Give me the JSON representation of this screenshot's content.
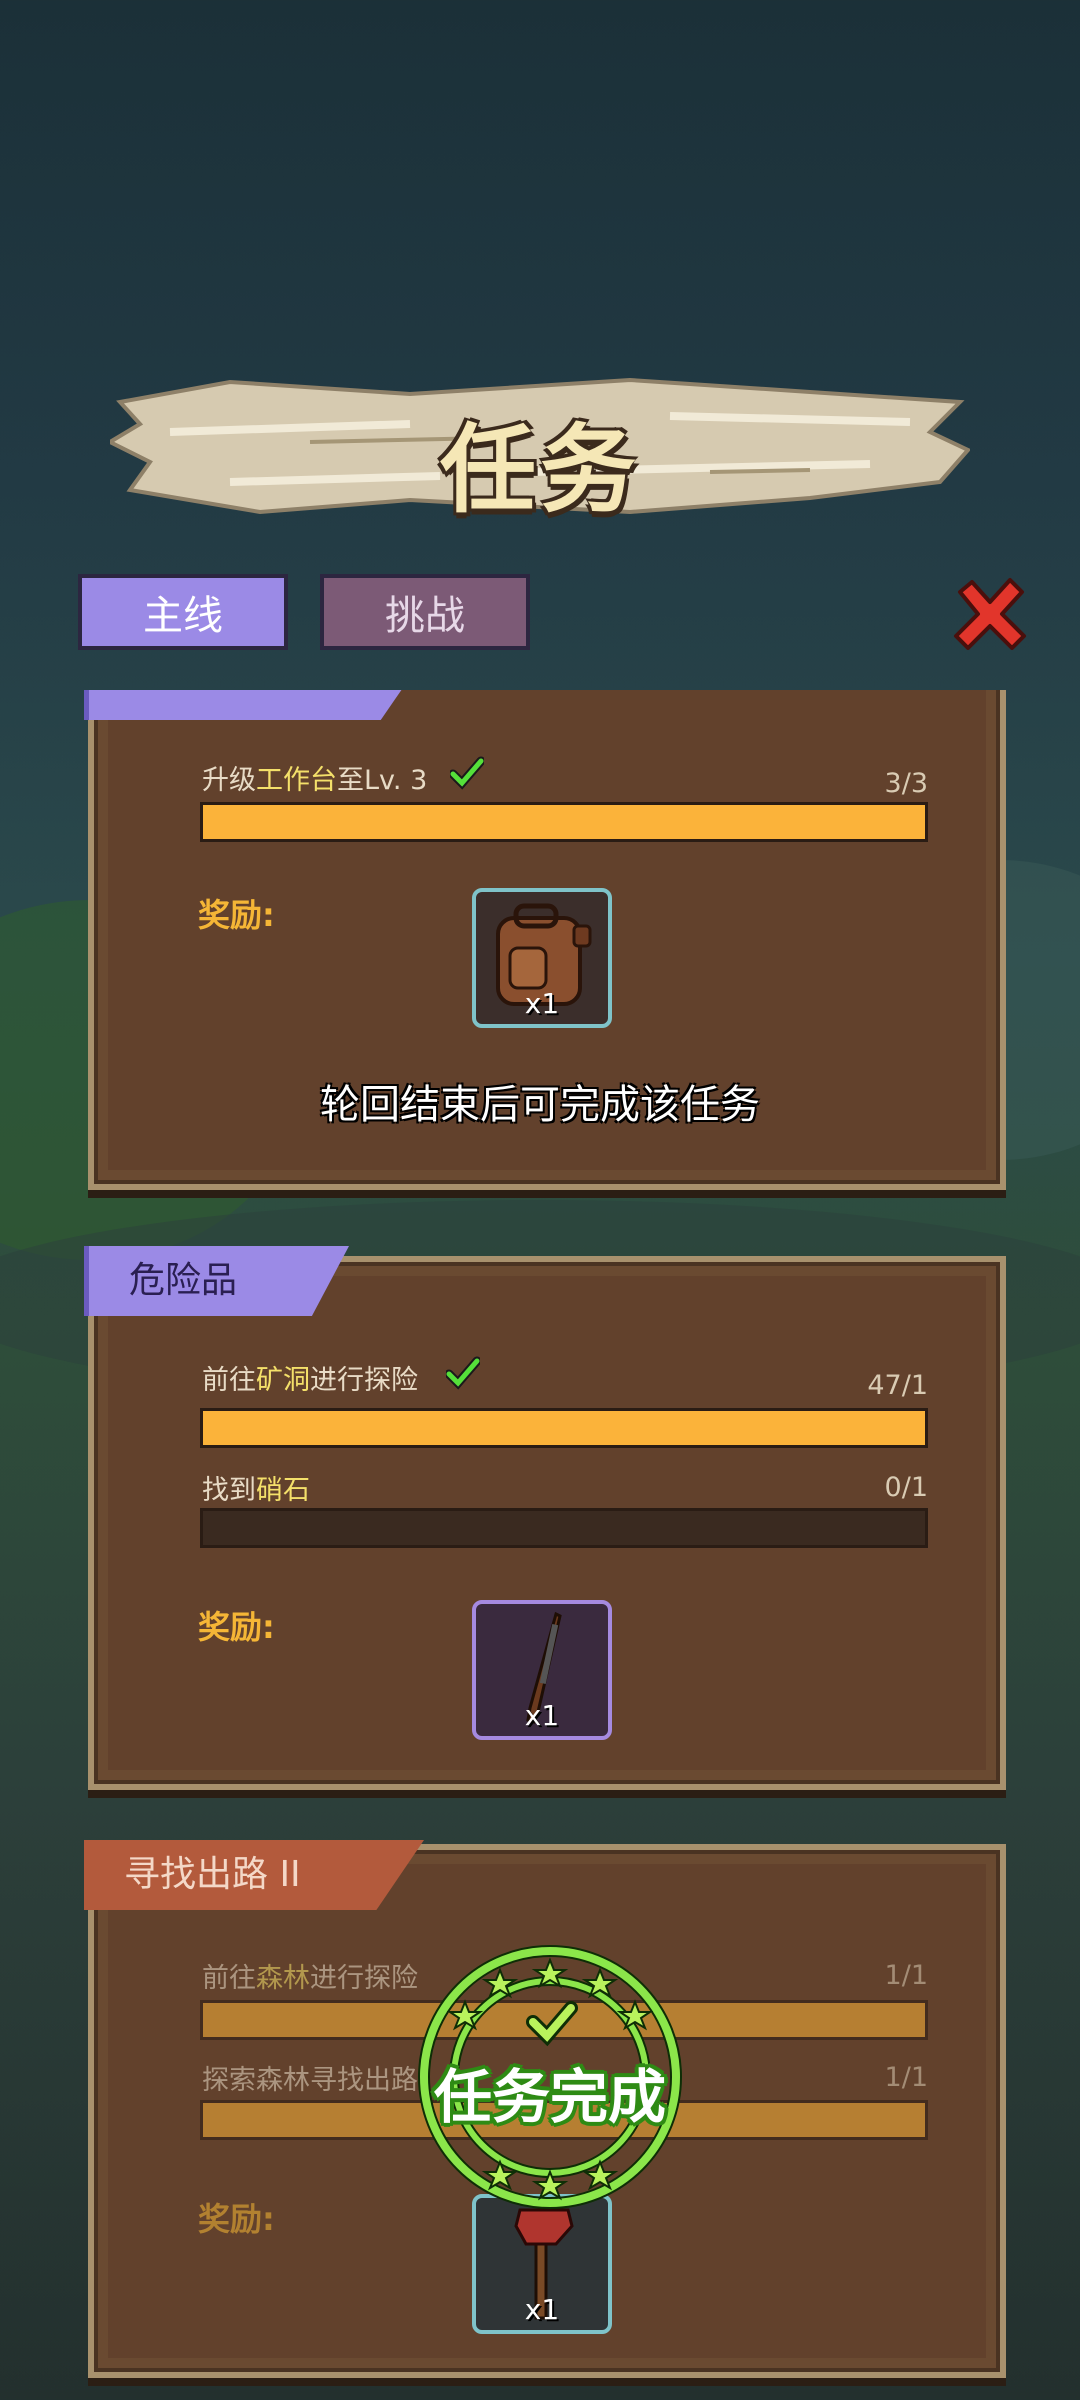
{
  "header": {
    "title": "任务"
  },
  "tabs": [
    {
      "label": "主线",
      "active": true
    },
    {
      "label": "挑战",
      "active": false
    }
  ],
  "quests": [
    {
      "tasks": [
        {
          "prefix": "升级",
          "highlight": "工作台",
          "suffix": "至Lv. 3",
          "count": "3/3",
          "progress": 1.0,
          "done": true
        }
      ],
      "reward_label": "奖励:",
      "reward_qty": "x1",
      "reward_icon": "backpack-icon",
      "notice": "轮回结束后可完成该任务"
    },
    {
      "ribbon": "危险品",
      "tasks": [
        {
          "prefix": "前往",
          "highlight": "矿洞",
          "suffix": "进行探险",
          "count": "47/1",
          "progress": 1.0,
          "done": true
        },
        {
          "prefix": "找到",
          "highlight": "硝石",
          "suffix": "",
          "count": "0/1",
          "progress": 0.0,
          "done": false
        }
      ],
      "reward_label": "奖励:",
      "reward_qty": "x1",
      "reward_icon": "rifle-icon"
    },
    {
      "ribbon": "寻找出路 II",
      "tasks": [
        {
          "prefix": "前往",
          "highlight": "森林",
          "suffix": "进行探险",
          "count": "1/1",
          "progress": 1.0,
          "done": true
        },
        {
          "prefix": "探索森林寻找出路",
          "highlight": "",
          "suffix": "",
          "count": "1/1",
          "progress": 1.0,
          "done": true
        }
      ],
      "reward_label": "奖励:",
      "reward_qty": "x1",
      "reward_icon": "axe-icon",
      "stamp": "任务完成"
    }
  ],
  "colors": {
    "bar_fill": "#fbb33a",
    "tab_active": "#9b8ae6",
    "tab_inactive": "#7c5a76",
    "highlight_text": "#f4e06a",
    "reward_label": "#f5b636",
    "stamp_green": "#7be03a"
  }
}
